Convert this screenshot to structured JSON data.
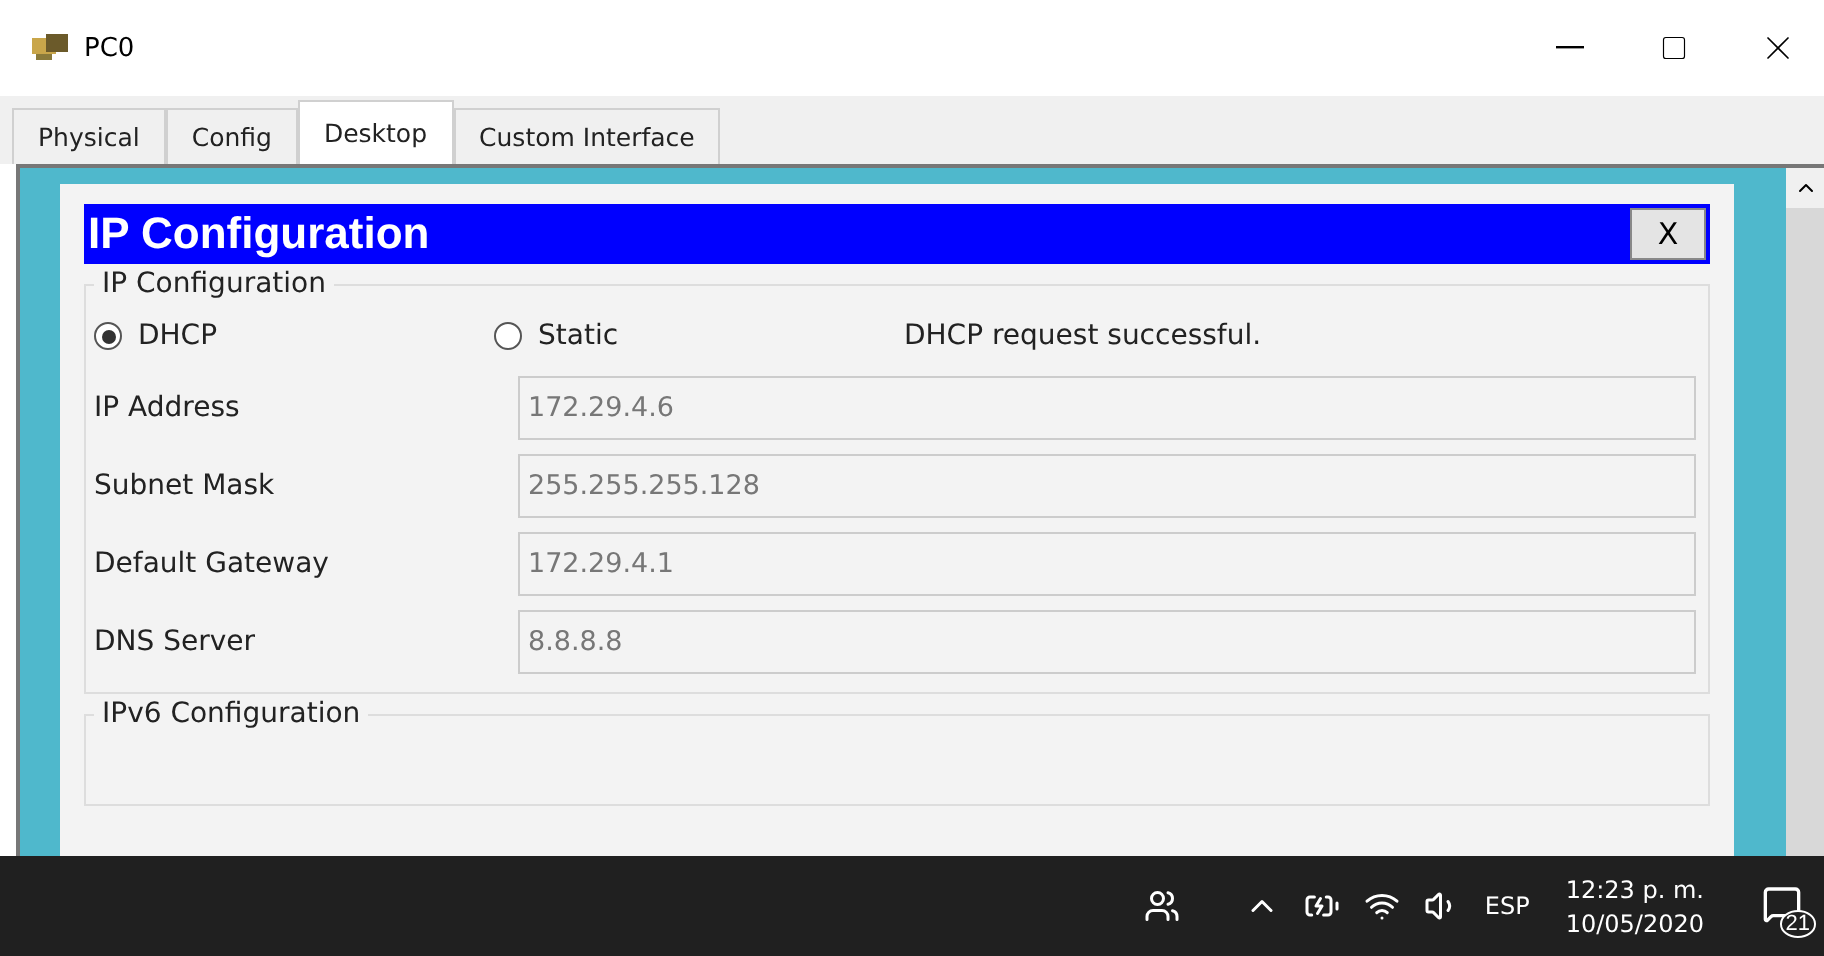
{
  "window": {
    "title": "PC0"
  },
  "tabs": [
    {
      "label": "Physical",
      "selected": false
    },
    {
      "label": "Config",
      "selected": false
    },
    {
      "label": "Desktop",
      "selected": true
    },
    {
      "label": "Custom Interface",
      "selected": false
    }
  ],
  "dialog": {
    "title": "IP Configuration",
    "close": "X",
    "ipv4": {
      "legend": "IP Configuration",
      "modes": [
        {
          "label": "DHCP",
          "selected": true
        },
        {
          "label": "Static",
          "selected": false
        }
      ],
      "status": "DHCP request successful.",
      "fields": [
        {
          "label": "IP Address",
          "value": "172.29.4.6",
          "disabled": true
        },
        {
          "label": "Subnet Mask",
          "value": "255.255.255.128",
          "disabled": true
        },
        {
          "label": "Default Gateway",
          "value": "172.29.4.1",
          "disabled": true
        },
        {
          "label": "DNS Server",
          "value": "8.8.8.8",
          "disabled": true
        }
      ]
    },
    "ipv6": {
      "legend": "IPv6 Configuration"
    }
  },
  "taskbar": {
    "language": "ESP",
    "time": "12:23 p. m.",
    "date": "10/05/2020",
    "notifications": "21"
  }
}
